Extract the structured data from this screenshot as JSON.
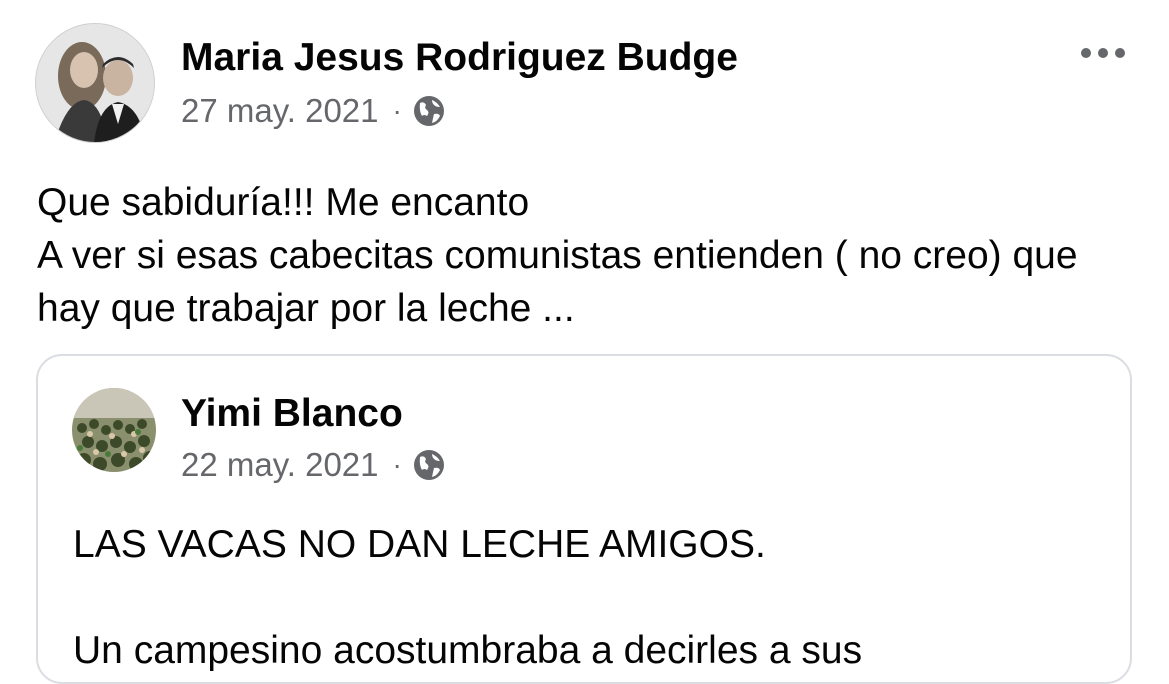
{
  "post": {
    "author": "Maria Jesus Rodriguez Budge",
    "date": "27 may. 2021",
    "separator": "·",
    "privacy_icon": "globe-icon",
    "menu_icon": "more-options-icon",
    "text_lines": [
      "Que sabiduría!!! Me encanto",
      "A ver si esas cabecitas comunistas entienden ( no creo) que hay que trabajar por la leche ..."
    ]
  },
  "shared": {
    "author": "Yimi Blanco",
    "date": "22 may. 2021",
    "separator": "·",
    "privacy_icon": "globe-icon",
    "text_lines": [
      "LAS VACAS NO DAN LECHE AMIGOS.",
      "Un campesino acostumbraba a decirles a sus"
    ]
  },
  "colors": {
    "text": "#050505",
    "secondary": "#65676b",
    "border": "#dadde1"
  }
}
